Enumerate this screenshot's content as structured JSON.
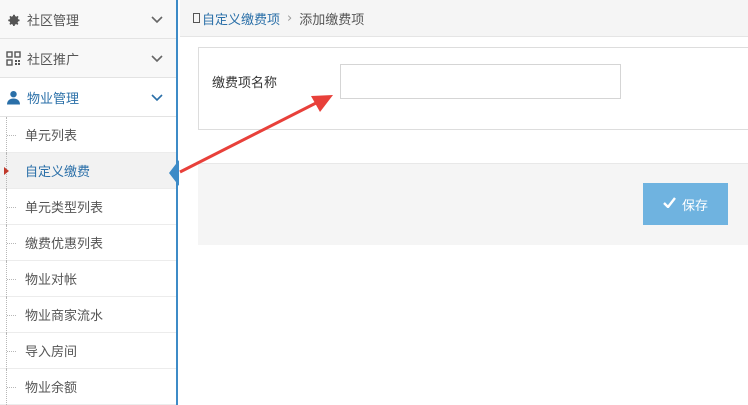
{
  "sidebar": {
    "menus": [
      {
        "label": "社区管理",
        "icon": "gear-icon",
        "expanded": false
      },
      {
        "label": "社区推广",
        "icon": "qrcode-icon",
        "expanded": false
      },
      {
        "label": "物业管理",
        "icon": "user-icon",
        "expanded": true
      }
    ],
    "sub_items": [
      {
        "label": "单元列表"
      },
      {
        "label": "自定义缴费",
        "active": true
      },
      {
        "label": "单元类型列表"
      },
      {
        "label": "缴费优惠列表"
      },
      {
        "label": "物业对帐"
      },
      {
        "label": "物业商家流水"
      },
      {
        "label": "导入房间"
      },
      {
        "label": "物业余额"
      }
    ]
  },
  "breadcrumb": {
    "link": "自定义缴费项",
    "separator": "›",
    "current": "添加缴费项"
  },
  "form": {
    "name_label": "缴费项名称",
    "name_value": "",
    "name_placeholder": ""
  },
  "actions": {
    "save_label": "保存",
    "save_icon": "check-icon"
  },
  "colors": {
    "accent": "#3d8bc7",
    "link": "#2a6fa8",
    "save_button": "#6fb3e0",
    "annotation_arrow": "#e8403a"
  }
}
